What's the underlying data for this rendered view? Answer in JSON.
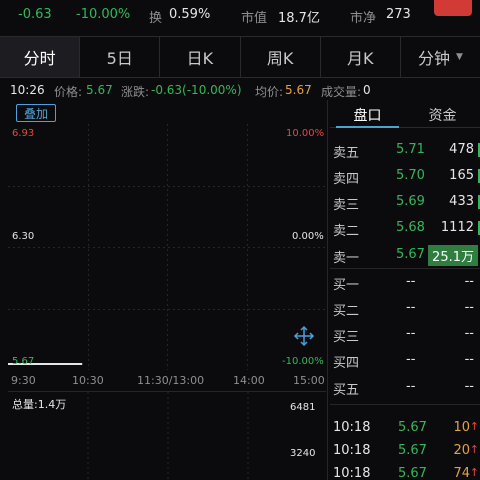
{
  "stats": {
    "change": "-0.63",
    "change_pct": "-10.00%",
    "turnover_label": "换",
    "turnover_value": "0.59%",
    "mktcap_label": "市值",
    "mktcap_value": "18.7亿",
    "pb_label": "市净",
    "pb_value": "273"
  },
  "tabs": [
    {
      "label": "分时"
    },
    {
      "label": "5日"
    },
    {
      "label": "日K"
    },
    {
      "label": "周K"
    },
    {
      "label": "月K"
    },
    {
      "label": "分钟"
    }
  ],
  "info": {
    "time": "10:26",
    "price_label": "价格:",
    "price": "5.67",
    "change_label": "涨跌:",
    "change": "-0.63(-10.00%)",
    "avg_label": "均价:",
    "avg": "5.67",
    "volume_label": "成交量:",
    "volume": "0"
  },
  "overlay_button": "叠加",
  "chart": {
    "price_high": "6.93",
    "price_mid": "6.30",
    "price_low": "5.67",
    "pct_high": "10.00%",
    "pct_mid": "0.00%",
    "pct_low": "-10.00%",
    "time_ticks": [
      "9:30",
      "10:30",
      "11:30/13:00",
      "14:00",
      "15:00"
    ],
    "volume_title": "总量:1.4万",
    "volume_max": "6481",
    "volume_mid": "3240"
  },
  "chart_data": {
    "type": "line",
    "x": [
      "9:30",
      "10:26"
    ],
    "values": [
      5.67,
      5.67
    ],
    "ylim": [
      5.67,
      6.93
    ],
    "yticks": [
      "6.93",
      "6.30",
      "5.67"
    ],
    "right_ticks": [
      "10.00%",
      "0.00%",
      "-10.00%"
    ],
    "xticks": [
      "9:30",
      "10:30",
      "11:30/13:00",
      "14:00",
      "15:00"
    ]
  },
  "panel_tabs": [
    {
      "label": "盘口"
    },
    {
      "label": "资金"
    }
  ],
  "order_book": [
    {
      "label": "卖五",
      "price": "5.71",
      "qty": "478"
    },
    {
      "label": "卖四",
      "price": "5.70",
      "qty": "165"
    },
    {
      "label": "卖三",
      "price": "5.69",
      "qty": "433"
    },
    {
      "label": "卖二",
      "price": "5.68",
      "qty": "1112"
    },
    {
      "label": "卖一",
      "price": "5.67",
      "qty": "25.1万"
    },
    {
      "label": "买一",
      "price": "--",
      "qty": "--"
    },
    {
      "label": "买二",
      "price": "--",
      "qty": "--"
    },
    {
      "label": "买三",
      "price": "--",
      "qty": "--"
    },
    {
      "label": "买四",
      "price": "--",
      "qty": "--"
    },
    {
      "label": "买五",
      "price": "--",
      "qty": "--"
    }
  ],
  "trades": [
    {
      "time": "10:18",
      "price": "5.67",
      "qty": "10",
      "arrow": "↑"
    },
    {
      "time": "10:18",
      "price": "5.67",
      "qty": "20",
      "arrow": "↑"
    },
    {
      "time": "10:18",
      "price": "5.67",
      "qty": "74",
      "arrow": "↑"
    }
  ],
  "colors": {
    "down_green": "#2fb85a",
    "up_red": "#e8463f",
    "avg_orange": "#e8a13a",
    "accent_blue": "#4aa3d8"
  }
}
